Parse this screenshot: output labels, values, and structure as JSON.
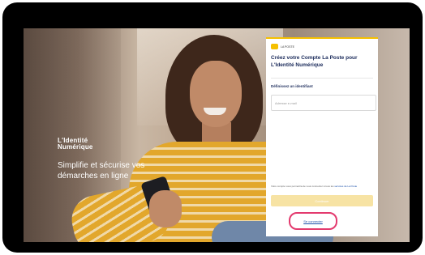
{
  "brand": {
    "line1": "L'Identité",
    "line2": "Numérique"
  },
  "tagline": "Simplifie et sécurise vos démarches en ligne",
  "card": {
    "logo_text": "LA POSTE",
    "title": "Créez votre Compte La Poste pour L'Identité Numérique",
    "field_label": "Définissez un identifiant",
    "email_placeholder": "Adresse e-mail",
    "consent_text": "Votre compte vous permettra de vous connecter à tous les ",
    "consent_link": "services de La Poste",
    "continue_label": "Continuer",
    "connect_label": "Se connecter"
  },
  "colors": {
    "accent_yellow": "#f5c000",
    "highlight_ring": "#e33a6e",
    "link_blue": "#1a4fa8",
    "title_navy": "#1a2a5a"
  }
}
